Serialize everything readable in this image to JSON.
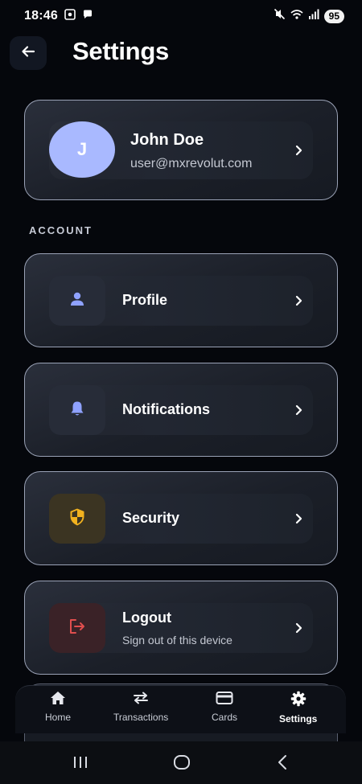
{
  "status_bar": {
    "time": "18:46",
    "battery": "95"
  },
  "header": {
    "title": "Settings"
  },
  "profile": {
    "initial": "J",
    "name": "John Doe",
    "email": "user@mxrevolut.com"
  },
  "section": {
    "account_label": "ACCOUNT"
  },
  "items": [
    {
      "label": "Profile",
      "icon": "person-icon",
      "icon_color": "#8fa2ff",
      "icon_bg": "#272c38"
    },
    {
      "label": "Notifications",
      "icon": "bell-icon",
      "icon_color": "#8fa2ff",
      "icon_bg": "#272c38"
    },
    {
      "label": "Security",
      "icon": "shield-icon",
      "icon_color": "#f2b21f",
      "icon_bg": "#3b3422"
    },
    {
      "label": "Logout",
      "subtitle": "Sign out of this device",
      "icon": "logout-icon",
      "icon_color": "#e04e4e",
      "icon_bg": "#3a2227"
    }
  ],
  "bottom_nav": {
    "items": [
      {
        "label": "Home",
        "icon": "home-icon"
      },
      {
        "label": "Transactions",
        "icon": "swap-arrows-icon"
      },
      {
        "label": "Cards",
        "icon": "card-icon"
      },
      {
        "label": "Settings",
        "icon": "gear-icon",
        "active": true
      }
    ]
  },
  "colors": {
    "background": "#05070c",
    "accent": "#a9b9ff",
    "card_border": "#9aa2b6"
  }
}
